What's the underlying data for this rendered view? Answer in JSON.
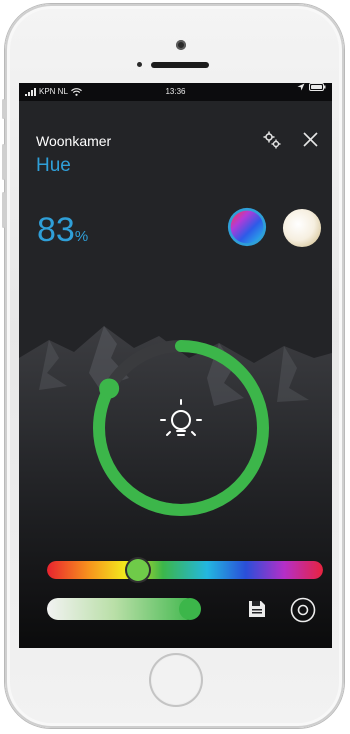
{
  "status_bar": {
    "carrier": "KPN NL",
    "time": "13:36"
  },
  "header": {
    "room": "Woonkamer",
    "mode": "Hue"
  },
  "brightness": {
    "value": "83",
    "unit": "%",
    "level": 0.83
  },
  "icons": {
    "settings": "gears-icon",
    "close": "close-icon",
    "lamp": "lightbulb-icon",
    "save": "floppy-disk-icon",
    "target": "target-icon"
  },
  "colors": {
    "accent_blue": "#2f9fd8",
    "ring_green": "#3cb64a",
    "background": "#232427"
  },
  "sliders": {
    "color_hue_position": 0.33,
    "white_level": 0.95
  }
}
